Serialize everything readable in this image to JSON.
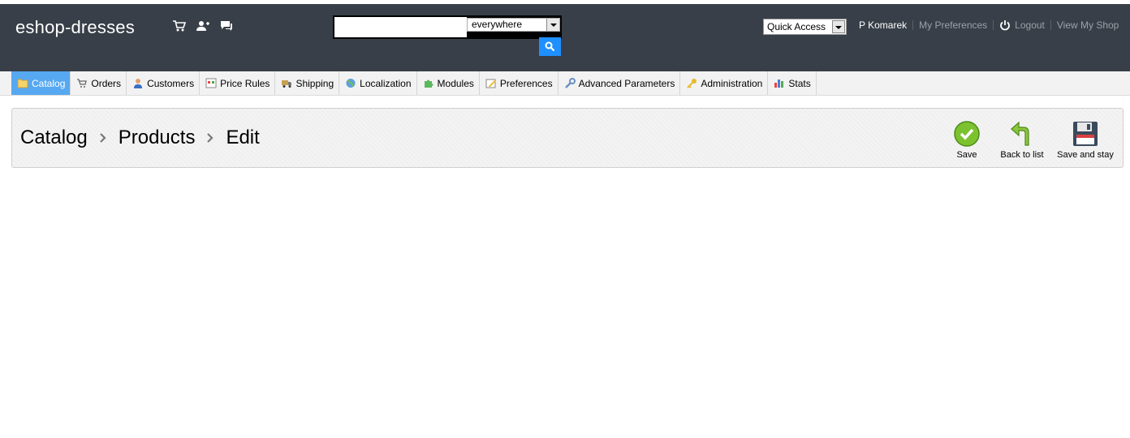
{
  "header": {
    "shop_name": "eshop-dresses",
    "quick_icons": [
      "cart-icon",
      "customers-icon",
      "messages-icon"
    ],
    "search": {
      "value": "",
      "placeholder": "",
      "scope": "everywhere"
    },
    "quick_access": "Quick Access",
    "user_name": "P Komarek",
    "preferences_link": "My Preferences",
    "logout_link": "Logout",
    "view_shop_link": "View My Shop"
  },
  "menu": {
    "items": [
      {
        "label": "Catalog",
        "icon": "folder-icon",
        "active": true
      },
      {
        "label": "Orders",
        "icon": "cart-icon"
      },
      {
        "label": "Customers",
        "icon": "user-icon"
      },
      {
        "label": "Price Rules",
        "icon": "price-rules-icon"
      },
      {
        "label": "Shipping",
        "icon": "truck-icon"
      },
      {
        "label": "Localization",
        "icon": "globe-icon"
      },
      {
        "label": "Modules",
        "icon": "puzzle-icon"
      },
      {
        "label": "Preferences",
        "icon": "preferences-icon"
      },
      {
        "label": "Advanced Parameters",
        "icon": "wrench-icon"
      },
      {
        "label": "Administration",
        "icon": "key-icon"
      },
      {
        "label": "Stats",
        "icon": "bar-chart-icon"
      }
    ]
  },
  "toolbar": {
    "breadcrumb": [
      "Catalog",
      "Products",
      "Edit"
    ],
    "save_label": "Save",
    "back_label": "Back to list",
    "save_stay_label": "Save and stay"
  },
  "colors": {
    "header_bg": "#383f48",
    "active_tab": "#56a8f0",
    "search_button": "#1e90ff"
  }
}
